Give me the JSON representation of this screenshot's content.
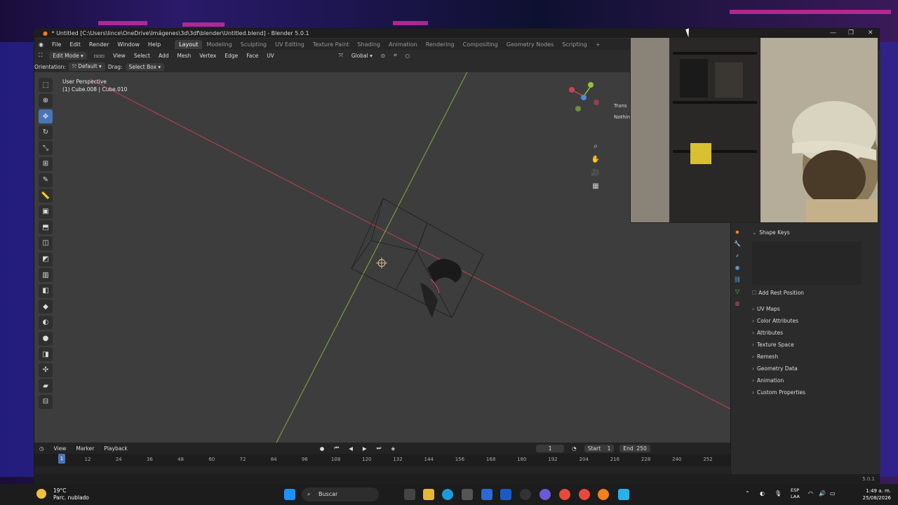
{
  "window": {
    "title": "* Untitled [C:\\Users\\lince\\OneDrive\\Imágenes\\3d\\3df\\blender\\Untitled.blend] - Blender 5.0.1",
    "minimize": "—",
    "maximize": "❐",
    "close": "✕"
  },
  "menubar": {
    "menus": [
      "File",
      "Edit",
      "Render",
      "Window",
      "Help"
    ],
    "workspaces": [
      "Layout",
      "Modeling",
      "Sculpting",
      "UV Editing",
      "Texture Paint",
      "Shading",
      "Animation",
      "Rendering",
      "Compositing",
      "Geometry Nodes",
      "Scripting"
    ],
    "active_workspace": "Layout",
    "add_tab": "+"
  },
  "viewport_header": {
    "mode": "Edit Mode",
    "menus": [
      "View",
      "Select",
      "Add",
      "Mesh",
      "Vertex",
      "Edge",
      "Face",
      "UV"
    ],
    "transform_orientation": "Global"
  },
  "tool_settings": {
    "orientation_label": "Orientation:",
    "orientation_value": "Default",
    "drag_label": "Drag:",
    "drag_value": "Select Box"
  },
  "viewport": {
    "perspective": "User Perspective",
    "object_info": "(1) Cube.008 | Cube.010",
    "sidebar_tab": "Trans",
    "sidebar_text": "Nothing"
  },
  "timeline": {
    "menus": [
      "View",
      "Marker",
      "Playback"
    ],
    "current_frame": "1",
    "start_label": "Start",
    "start_value": "1",
    "end_label": "End",
    "end_value": "250",
    "ruler_ticks": [
      "12",
      "24",
      "36",
      "48",
      "60",
      "72",
      "84",
      "96",
      "108",
      "120",
      "132",
      "144",
      "156",
      "168",
      "180",
      "192",
      "204",
      "216",
      "228",
      "240",
      "252"
    ],
    "playhead": "1"
  },
  "statusbar": {
    "version": "5.0.1"
  },
  "properties": {
    "shape_keys": "Shape Keys",
    "add_rest_position": "Add Rest Position",
    "sections": [
      "UV Maps",
      "Color Attributes",
      "Attributes",
      "Texture Space",
      "Remesh",
      "Geometry Data",
      "Animation",
      "Custom Properties"
    ]
  },
  "taskbar": {
    "weather_temp": "19°C",
    "weather_desc": "Parc. nublado",
    "search_placeholder": "Buscar",
    "lang_1": "ESP",
    "lang_2": "LAA",
    "time": "1:49 a. m.",
    "date": "25/08/2026"
  },
  "colors": {
    "accent": "#4a74b8",
    "x_axis": "#d0405a",
    "y_axis": "#8cc63a",
    "z_axis": "#4a8ee0"
  }
}
